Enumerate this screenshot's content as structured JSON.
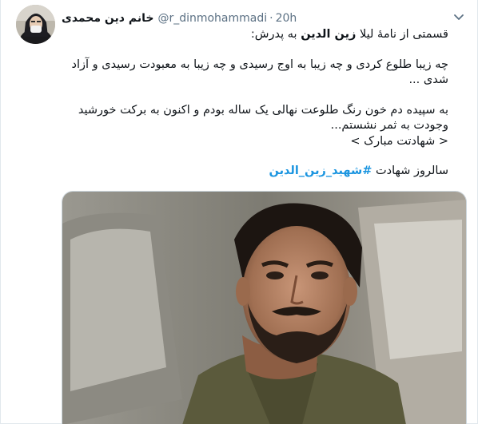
{
  "tweet": {
    "display_name": "خانم دین محمدی",
    "handle": "@r_dinmohammadi",
    "separator": "·",
    "time": "20h",
    "intro_pre": "قسمتی از نامهٔ لیلا ",
    "intro_bold": "زین الدین",
    "intro_post": " به پدرش:",
    "line1": "چه زیبا طلوع کردی و چه زیبا به اوج رسیدی و چه زیبا به معبودت رسیدی و آزاد",
    "line2": "شدی ...",
    "line3": "به سپیده دم خون رنگ طلوعت نهالی یک ساله بودم و اکنون به برکت خورشید",
    "line4": "وجودت به ثمر نشستم...",
    "line5": "< شهادتت مبارک >",
    "tag_pre": "سالروز شهادت ",
    "hashtag": "#شهید_زین_الدین"
  },
  "icons": {
    "more": "chevron-down-icon",
    "avatar": "avatar"
  },
  "colors": {
    "text": "#0f1419",
    "secondary": "#5b7083",
    "link": "#1b95e0",
    "border": "#e1e8ed"
  }
}
